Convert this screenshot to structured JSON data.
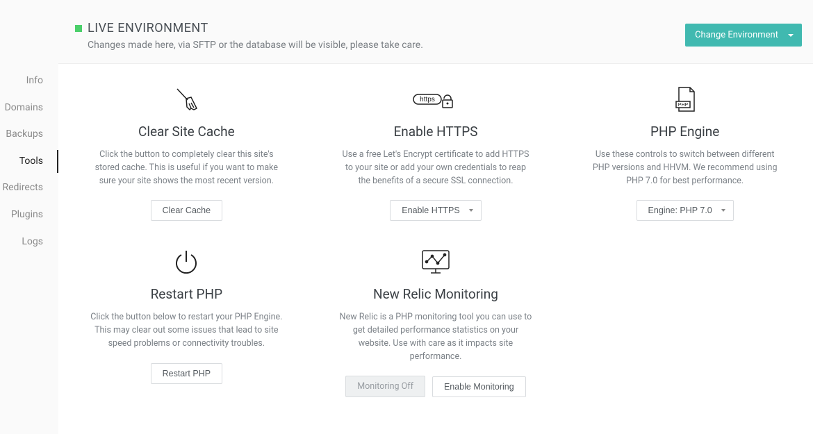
{
  "header": {
    "title": "LIVE ENVIRONMENT",
    "subtitle": "Changes made here, via SFTP or the database will be visible, please take care.",
    "env_button": "Change Environment"
  },
  "sidebar": {
    "items": [
      {
        "label": "Info"
      },
      {
        "label": "Domains"
      },
      {
        "label": "Backups"
      },
      {
        "label": "Tools"
      },
      {
        "label": "Redirects"
      },
      {
        "label": "Plugins"
      },
      {
        "label": "Logs"
      }
    ]
  },
  "tools": {
    "clear_cache": {
      "title": "Clear Site Cache",
      "desc": "Click the button to completely clear this site's stored cache. This is useful if you want to make sure your site shows the most recent version.",
      "button": "Clear Cache"
    },
    "enable_https": {
      "title": "Enable HTTPS",
      "desc": "Use a free Let's Encrypt certificate to add HTTPS to your site or add your own credentials to reap the benefits of a secure SSL connection.",
      "button": "Enable HTTPS"
    },
    "php_engine": {
      "title": "PHP Engine",
      "desc": "Use these controls to switch between different PHP versions and HHVM. We recommend using PHP 7.0 for best performance.",
      "button": "Engine: PHP 7.0"
    },
    "restart_php": {
      "title": "Restart PHP",
      "desc": "Click the button below to restart your PHP Engine. This may clear out some issues that lead to site speed problems or connectivity troubles.",
      "button": "Restart PHP"
    },
    "new_relic": {
      "title": "New Relic Monitoring",
      "desc": "New Relic is a PHP monitoring tool you can use to get detailed performance statistics on your website. Use with care as it impacts site performance.",
      "status": "Monitoring Off",
      "button": "Enable Monitoring"
    }
  }
}
